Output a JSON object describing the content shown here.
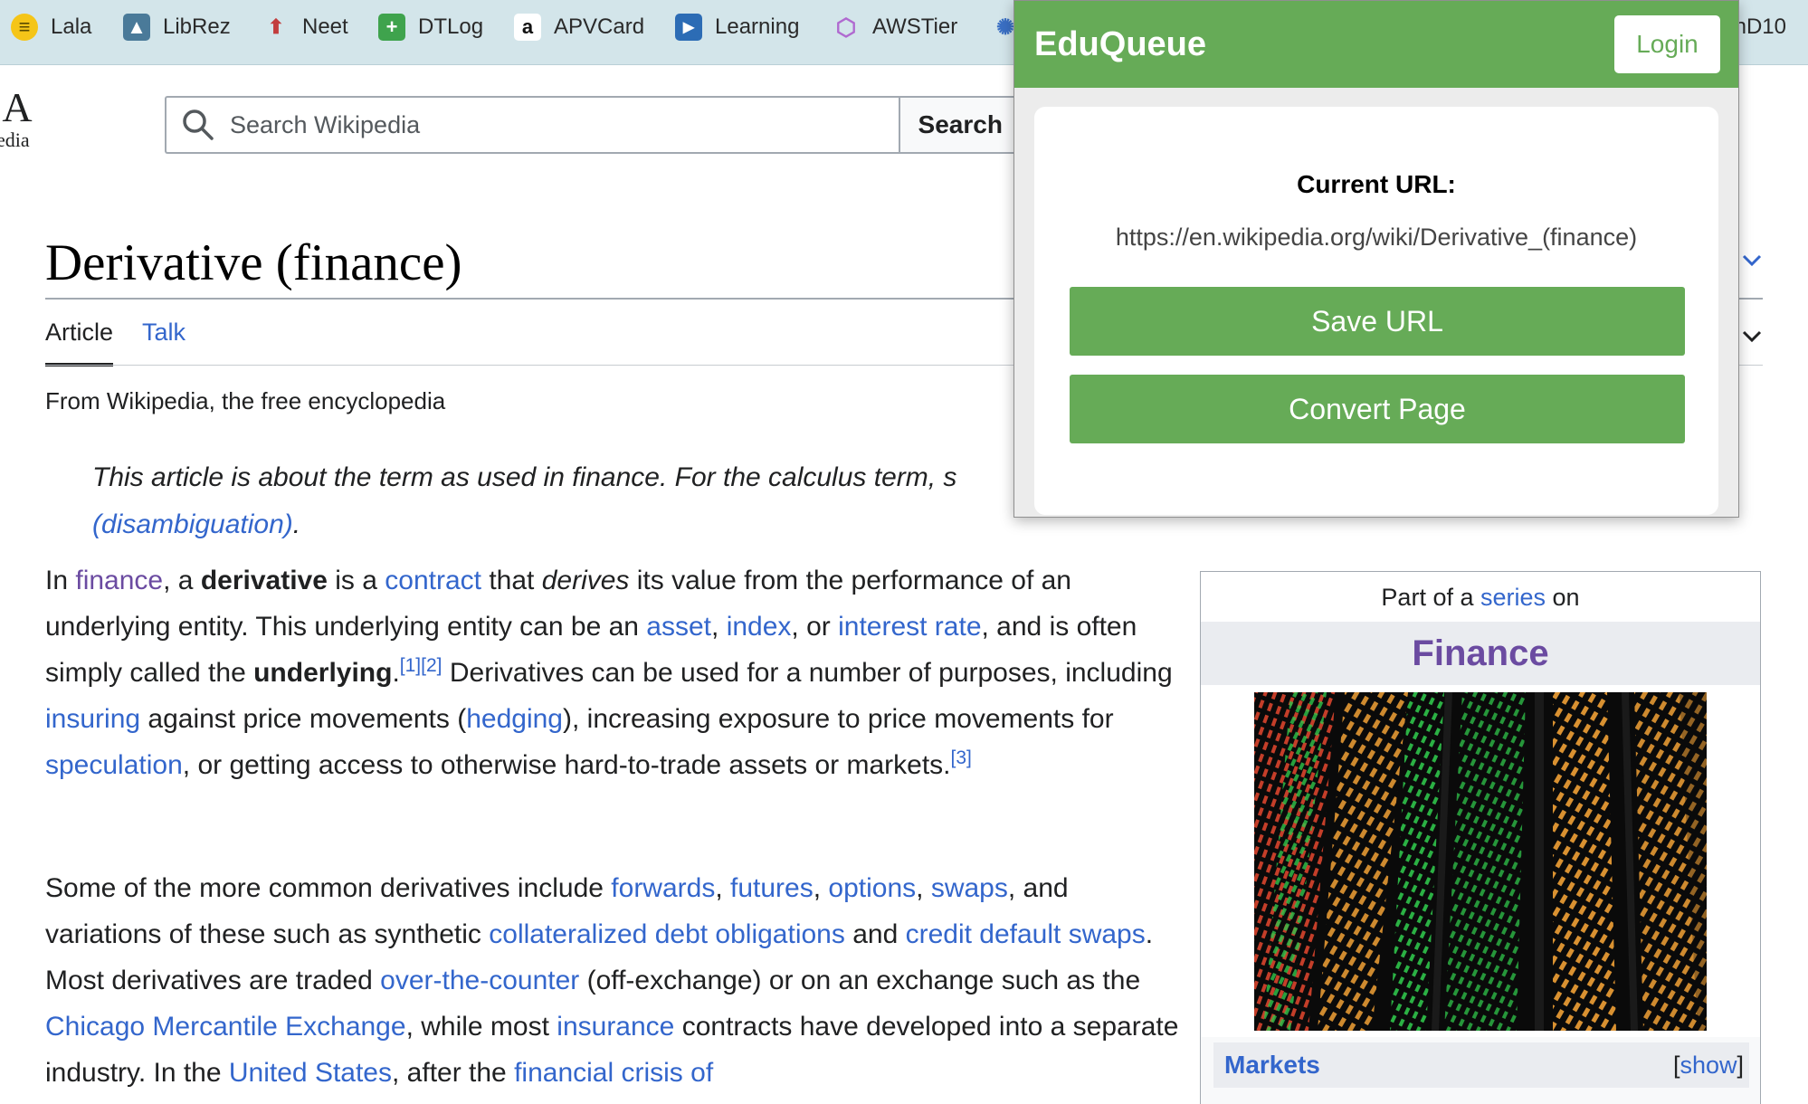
{
  "bookmarks": [
    {
      "label": "Lala",
      "icon": "lala-icon"
    },
    {
      "label": "LibRez",
      "icon": "librez-icon"
    },
    {
      "label": "Neet",
      "icon": "rocket-icon"
    },
    {
      "label": "DTLog",
      "icon": "plus-icon"
    },
    {
      "label": "APVCard",
      "icon": "amazon-icon"
    },
    {
      "label": "Learning",
      "icon": "play-icon"
    },
    {
      "label": "AWSTier",
      "icon": "cube-icon"
    }
  ],
  "bookmark_right": "nD10",
  "wiki": {
    "logo_line1": "IA",
    "logo_line2": "edia",
    "search_placeholder": "Search Wikipedia",
    "search_button": "Search",
    "title": "Derivative (finance)",
    "tabs": [
      "Article",
      "Talk"
    ],
    "from": "From Wikipedia, the free encyclopedia",
    "hatnote": {
      "text": "This article is about the term as used in finance. For the calculus term, s",
      "link": "(disambiguation)",
      "end": "."
    },
    "para1": {
      "t1": "In ",
      "l_finance": "finance",
      "t2": ", a ",
      "b_derivative": "derivative",
      "t3": " is a ",
      "l_contract": "contract",
      "t4": " that ",
      "i_derives": "derives",
      "t5": " its value from the performance of an underlying entity. This underlying entity can be an ",
      "l_asset": "asset",
      "t6": ", ",
      "l_index": "index",
      "t7": ", or ",
      "l_interest": "interest rate",
      "t8": ", and is often simply called the ",
      "b_underlying": "underlying",
      "t9": ".",
      "ref1": "[1]",
      "ref2": "[2]",
      "t10": " Derivatives can be used for a number of purposes, including ",
      "l_insuring": "insuring",
      "t11": " against price movements (",
      "l_hedging": "hedging",
      "t12": "), increasing exposure to price movements for ",
      "l_speculation": "speculation",
      "t13": ", or getting access to otherwise hard-to-trade assets or markets.",
      "ref3": "[3]"
    },
    "para2": {
      "t1": "Some of the more common derivatives include ",
      "l_forwards": "forwards",
      "c1": ", ",
      "l_futures": "futures",
      "c2": ", ",
      "l_options": "options",
      "c3": ", ",
      "l_swaps": "swaps",
      "t2": ", and variations of these such as synthetic ",
      "l_cdo": "collateralized debt obligations",
      "t3": " and ",
      "l_cds": "credit default swaps",
      "t4": ". Most derivatives are traded ",
      "l_otc": "over-the-counter",
      "t5": " (off-exchange) or on an exchange such as the ",
      "l_cme": "Chicago Mercantile Exchange",
      "t6": ", while most ",
      "l_insurance": "insurance",
      "t7": " contracts have developed into a separate industry. In the ",
      "l_us": "United States",
      "t8": ", after the ",
      "l_crisis": "financial crisis of"
    },
    "infobox": {
      "part_of": "Part of a ",
      "series_link": "series",
      "on": " on",
      "heading": "Finance",
      "markets": "Markets",
      "show_open": "[",
      "show": "show",
      "show_close": "]"
    }
  },
  "popup": {
    "title": "EduQueue",
    "login": "Login",
    "current_url_label": "Current URL:",
    "current_url": "https://en.wikipedia.org/wiki/Derivative_(finance)",
    "save_url": "Save URL",
    "convert_page": "Convert Page",
    "accent": "#66ab57"
  }
}
